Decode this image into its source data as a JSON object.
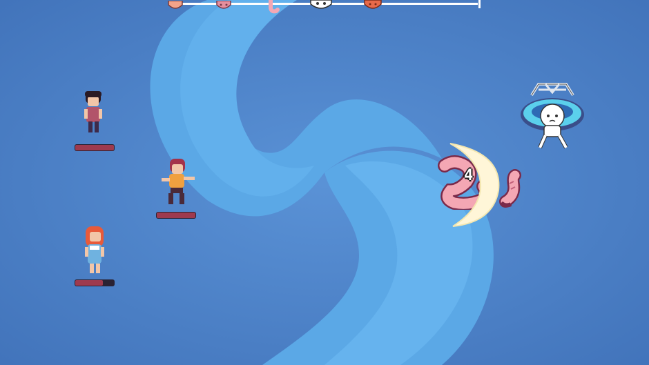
{
  "scene": {
    "type": "battle",
    "colors": {
      "bg_dark": "#4a7fc4",
      "bg_swirl": "#5ba8e6",
      "hp_fill": "#9e3a4e",
      "hp_track": "#2a2233"
    }
  },
  "turn_order": {
    "icons": [
      {
        "name": "party-member-face",
        "color": "#f2a38a"
      },
      {
        "name": "party-member-face",
        "color": "#e58f9e"
      },
      {
        "name": "worm-enemy-icon",
        "color": "#f4a7b4"
      },
      {
        "name": "ghost-enemy-face",
        "color": "#ffffff"
      },
      {
        "name": "party-member-face",
        "color": "#e86a4a"
      }
    ]
  },
  "party": [
    {
      "id": "boy-dark-hair",
      "hp": 1.0
    },
    {
      "id": "boy-orange-shirt",
      "hp": 1.0
    },
    {
      "id": "girl-red-hair",
      "hp": 0.72
    }
  ],
  "enemies": [
    {
      "id": "pink-worm"
    },
    {
      "id": "ufo-ghost"
    }
  ],
  "effects": {
    "crescent_slash": {
      "color": "#fff6d8"
    },
    "damage_number": "4"
  }
}
